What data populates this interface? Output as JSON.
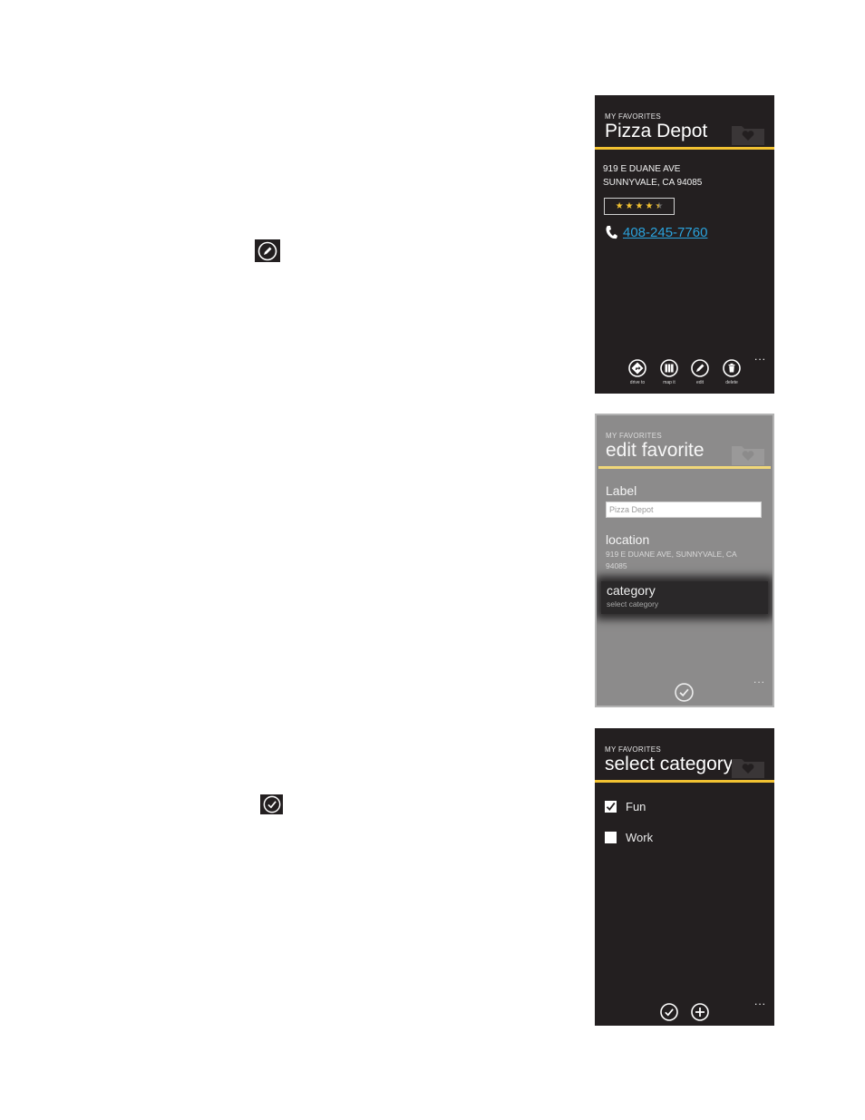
{
  "colors": {
    "accent": "#f2c232",
    "phone_bg": "#231f20",
    "link": "#2aa2dc",
    "dim_bg": "#8c8b8b"
  },
  "inline_icons": [
    {
      "name": "edit-icon"
    },
    {
      "name": "check-icon"
    }
  ],
  "screen1": {
    "app_title": "MY FAVORITES",
    "page_title": "Pizza Depot",
    "address_line1": "919 E DUANE AVE",
    "address_line2": "SUNNYVALE, CA 94085",
    "rating": 4.5,
    "rating_max": 5,
    "phone_number": "408-245-7760",
    "appbar": [
      {
        "label": "drive to",
        "icon": "directions-icon"
      },
      {
        "label": "map it",
        "icon": "map-icon"
      },
      {
        "label": "edit",
        "icon": "edit-icon"
      },
      {
        "label": "delete",
        "icon": "delete-icon"
      }
    ],
    "more": "..."
  },
  "screen2": {
    "app_title": "MY FAVORITES",
    "page_title": "edit favorite",
    "label_heading": "Label",
    "label_value": "Pizza Depot",
    "location_heading": "location",
    "location_value": "919 E DUANE AVE, SUNNYVALE, CA 94085",
    "category_heading": "category",
    "category_value": "select category",
    "more": "..."
  },
  "screen3": {
    "app_title": "MY FAVORITES",
    "page_title": "select category",
    "categories": [
      {
        "label": "Fun",
        "checked": true
      },
      {
        "label": "Work",
        "checked": false
      }
    ],
    "appbar": [
      {
        "icon": "check-icon"
      },
      {
        "icon": "add-icon"
      }
    ],
    "more": "..."
  }
}
